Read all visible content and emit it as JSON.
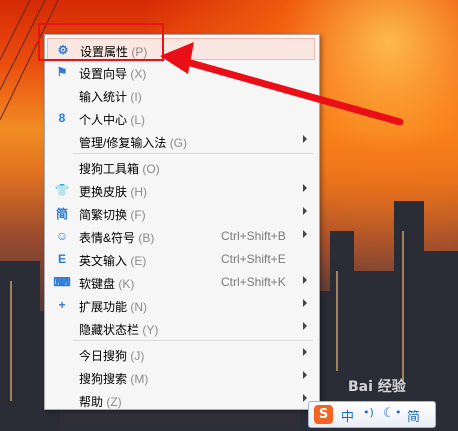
{
  "menu": {
    "items": [
      {
        "label": "设置属性",
        "key": "(P)",
        "icon": "gear-icon",
        "glyph": "⚙",
        "shortcut": "",
        "submenu": false,
        "highlighted": true
      },
      {
        "label": "设置向导",
        "key": "(X)",
        "icon": "flag-icon",
        "glyph": "⚑",
        "shortcut": "",
        "submenu": false
      },
      {
        "label": "输入统计",
        "key": "(I)",
        "icon": "",
        "glyph": "",
        "shortcut": "",
        "submenu": false
      },
      {
        "label": "个人中心",
        "key": "(L)",
        "icon": "user-icon",
        "glyph": "8",
        "shortcut": "",
        "submenu": false
      },
      {
        "label": "管理/修复输入法",
        "key": "(G)",
        "icon": "",
        "glyph": "",
        "shortcut": "",
        "submenu": true
      },
      {
        "label": "搜狗工具箱",
        "key": "(O)",
        "icon": "",
        "glyph": "",
        "shortcut": "",
        "submenu": false
      },
      {
        "label": "更换皮肤",
        "key": "(H)",
        "icon": "shirt-icon",
        "glyph": "👕",
        "shortcut": "",
        "submenu": true
      },
      {
        "label": "简繁切换",
        "key": "(F)",
        "icon": "simplified-char-icon",
        "glyph": "简",
        "shortcut": "",
        "submenu": true
      },
      {
        "label": "表情&符号",
        "key": "(B)",
        "icon": "smiley-icon",
        "glyph": "☺",
        "shortcut": "Ctrl+Shift+B",
        "submenu": true
      },
      {
        "label": "英文输入",
        "key": "(E)",
        "icon": "english-e-icon",
        "glyph": "E",
        "shortcut": "Ctrl+Shift+E",
        "submenu": false
      },
      {
        "label": "软键盘",
        "key": "(K)",
        "icon": "keyboard-icon",
        "glyph": "⌨",
        "shortcut": "Ctrl+Shift+K",
        "submenu": true
      },
      {
        "label": "扩展功能",
        "key": "(N)",
        "icon": "plus-icon",
        "glyph": "+",
        "shortcut": "",
        "submenu": true
      },
      {
        "label": "隐藏状态栏",
        "key": "(Y)",
        "icon": "",
        "glyph": "",
        "shortcut": "",
        "submenu": true
      },
      {
        "label": "今日搜狗",
        "key": "(J)",
        "icon": "",
        "glyph": "",
        "shortcut": "",
        "submenu": true
      },
      {
        "label": "搜狗搜索",
        "key": "(M)",
        "icon": "",
        "glyph": "",
        "shortcut": "",
        "submenu": true
      },
      {
        "label": "帮助",
        "key": "(Z)",
        "icon": "",
        "glyph": "",
        "shortcut": "",
        "submenu": true
      }
    ]
  },
  "tray": {
    "logo": "S",
    "mode": "中",
    "punct": "•)",
    "moon": "☾",
    "char": "简"
  },
  "watermark": "Bai 经验",
  "colors": {
    "accent": "#2b7ad4",
    "highlight": "#fbe7e2",
    "annotation_red": "#e8131a",
    "tray_logo": "#f26422"
  }
}
